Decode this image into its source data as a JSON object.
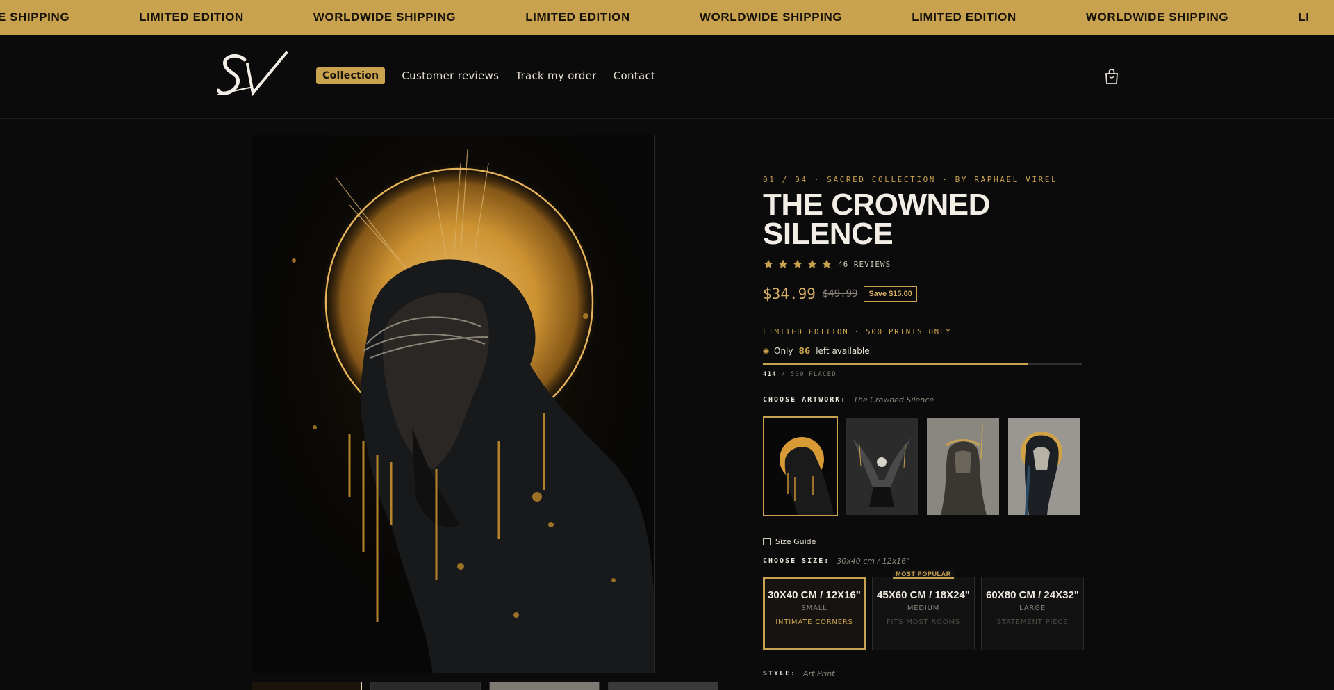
{
  "marquee": [
    "WIDE SHIPPING",
    "LIMITED EDITION",
    "WORLDWIDE SHIPPING",
    "LIMITED EDITION",
    "WORLDWIDE SHIPPING",
    "LIMITED EDITION",
    "WORLDWIDE SHIPPING",
    "LI"
  ],
  "nav": {
    "items": [
      {
        "label": "Collection",
        "active": true
      },
      {
        "label": "Customer reviews"
      },
      {
        "label": "Track my order"
      },
      {
        "label": "Contact"
      }
    ]
  },
  "product": {
    "eyebrow": "01 / 04 · SACRED COLLECTION · BY RAPHAEL VIREL",
    "title": "THE CROWNED SILENCE",
    "rating": 5,
    "reviews": "46 REVIEWS",
    "price": "$34.99",
    "price_old": "$49.99",
    "save": "Save $15.00",
    "limited": "LIMITED EDITION · 500 PRINTS ONLY",
    "stock_prefix": "Only",
    "stock_count": "86",
    "stock_suffix": "left available",
    "placed_count": "414",
    "placed_total": "/ 500 PLACED",
    "placed_fraction": 0.828,
    "choose_artwork_label": "CHOOSE ARTWORK:",
    "choose_artwork_value": "The Crowned Silence",
    "size_guide": "Size Guide",
    "choose_size_label": "CHOOSE SIZE:",
    "choose_size_value": "30x40 cm / 12x16\"",
    "style_label": "STYLE:",
    "style_value": "Art Print",
    "sizes": [
      {
        "name": "30X40 CM / 12X16\"",
        "tier": "SMALL",
        "desc": "INTIMATE CORNERS",
        "selected": true
      },
      {
        "name": "45X60 CM / 18X24\"",
        "tier": "MEDIUM",
        "desc": "FITS MOST ROOMS",
        "badge": "MOST POPULAR"
      },
      {
        "name": "60X80 CM / 24X32\"",
        "tier": "LARGE",
        "desc": "STATEMENT PIECE"
      }
    ]
  },
  "colors": {
    "accent": "#c9a24f",
    "background": "#0b0b0b"
  }
}
